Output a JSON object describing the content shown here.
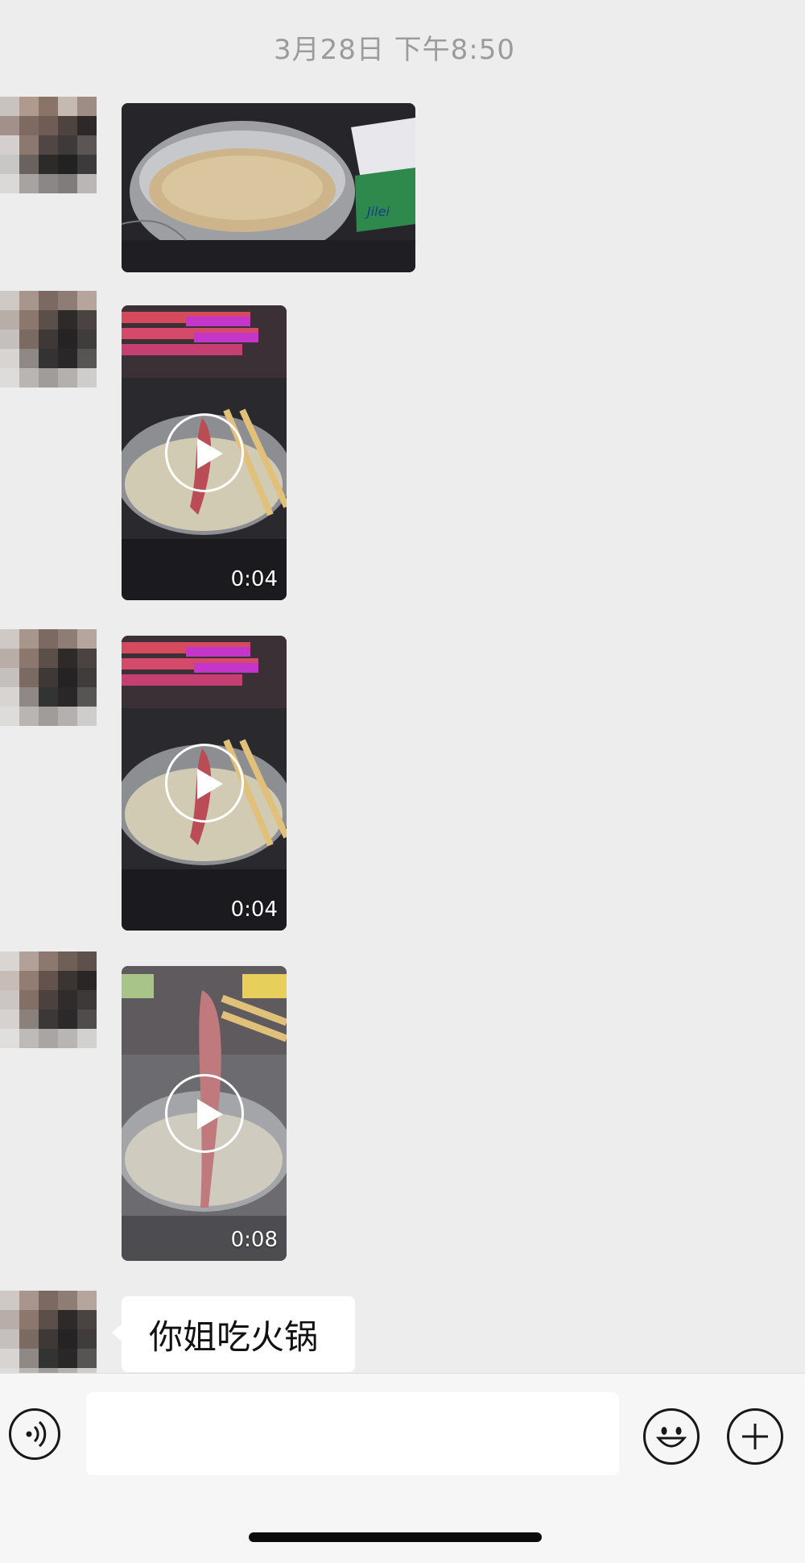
{
  "chat": {
    "timestamp": "3月28日 下午8:50",
    "messages": [
      {
        "type": "image"
      },
      {
        "type": "video",
        "duration": "0:04"
      },
      {
        "type": "video",
        "duration": "0:04"
      },
      {
        "type": "video",
        "duration": "0:08"
      },
      {
        "type": "text",
        "text": "你姐吃火锅"
      }
    ]
  },
  "input_bar": {
    "voice_icon": "voice-icon",
    "emoji_icon": "emoji-icon",
    "plus_icon": "plus-icon",
    "placeholder": ""
  }
}
